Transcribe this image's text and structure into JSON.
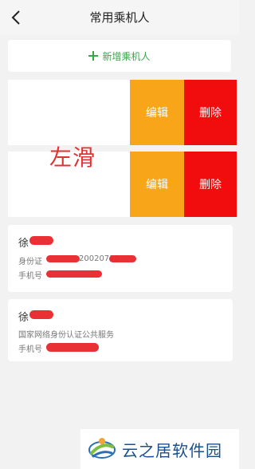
{
  "header": {
    "title": "常用乘机人"
  },
  "add_passenger": {
    "label": "新增乘机人"
  },
  "swipe_rows": [
    {
      "edit_label": "编辑",
      "delete_label": "删除"
    },
    {
      "edit_label": "编辑",
      "delete_label": "删除"
    }
  ],
  "swipe_hint": "左滑",
  "passengers": [
    {
      "name": "徐",
      "id_label": "身份证",
      "id_visible": "20020710",
      "phone_label": "手机号"
    },
    {
      "name": "徐",
      "id_label": "国家网络身份认证公共服务",
      "phone_label": "手机号"
    }
  ],
  "watermark": {
    "text": "云之居软件园"
  },
  "colors": {
    "accent_green": "#3aa64a",
    "edit_orange": "#f9a51a",
    "delete_red": "#f10d0d"
  }
}
